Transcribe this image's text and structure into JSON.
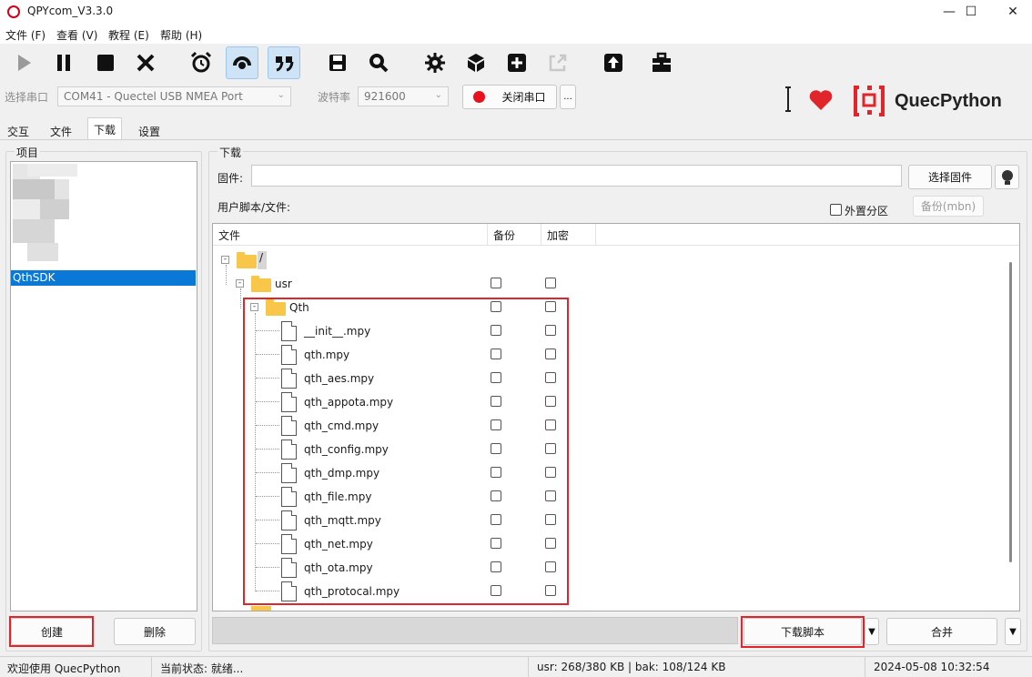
{
  "window": {
    "title": "QPYcom_V3.3.0"
  },
  "menu": [
    "文件 (F)",
    "查看 (V)",
    "教程 (E)",
    "帮助 (H)"
  ],
  "toolbar": {
    "icons": [
      "play-icon",
      "pause-icon",
      "stop-icon",
      "close-icon",
      "alarm-clock-icon",
      "headset-icon",
      "quote-icon",
      "save-icon",
      "search-icon",
      "gear-icon",
      "cube-icon",
      "plus-square-icon",
      "external-link-icon",
      "upload-icon",
      "toolbox-icon"
    ]
  },
  "port": {
    "label": "选择串口",
    "value": "COM41 - Quectel USB NMEA Port",
    "baud_label": "波特率",
    "baud_value": "921600",
    "toggle_label": "关闭串口",
    "more_label": "..."
  },
  "brand": {
    "text": "QuecPython",
    "accent": "#e0262a"
  },
  "tabs": [
    "交互",
    "文件",
    "下载",
    "设置"
  ],
  "project": {
    "group_label": "项目",
    "selected_item": "QthSDK",
    "create_label": "创建",
    "delete_label": "删除"
  },
  "download": {
    "group_label": "下载",
    "firmware_label": "固件:",
    "firmware_value": "",
    "select_firmware_label": "选择固件",
    "user_scripts_label": "用户脚本/文件:",
    "external_partition_label": "外置分区",
    "backup_mbn_label": "备份(mbn)",
    "columns": [
      "文件",
      "备份",
      "加密"
    ],
    "root": "/",
    "usr": "usr",
    "qth": "Qth",
    "files": [
      "__init__.mpy",
      "qth.mpy",
      "qth_aes.mpy",
      "qth_appota.mpy",
      "qth_cmd.mpy",
      "qth_config.mpy",
      "qth_dmp.mpy",
      "qth_file.mpy",
      "qth_mqtt.mpy",
      "qth_net.mpy",
      "qth_ota.mpy",
      "qth_protocal.mpy"
    ],
    "download_script_label": "下载脚本",
    "merge_label": "合并"
  },
  "status": {
    "welcome": "欢迎使用 QuecPython",
    "state": "当前状态: 就绪...",
    "memory": "usr: 268/380 KB | bak: 108/124 KB",
    "datetime": "2024-05-08 10:32:54"
  }
}
